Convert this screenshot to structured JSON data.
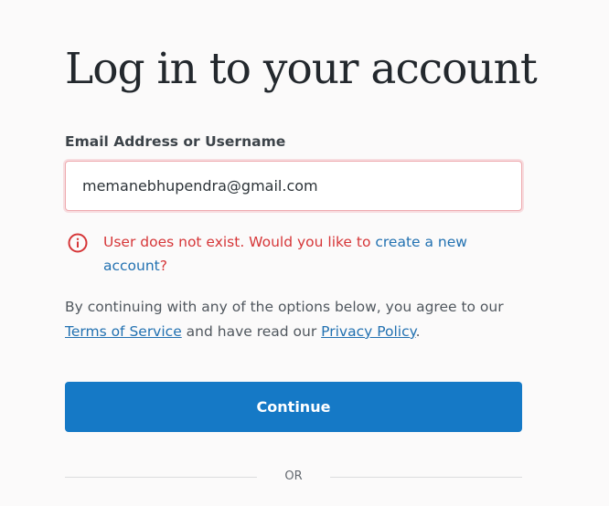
{
  "page": {
    "title": "Log in to your account"
  },
  "form": {
    "email_label": "Email Address or Username",
    "email_value": "memanebhupendra@gmail.com"
  },
  "error": {
    "icon": "alert-circle-icon",
    "prefix": "User does not exist. Would you like to ",
    "link_text": "create a new account",
    "suffix": "?",
    "color": "#d63638"
  },
  "terms": {
    "prefix": "By continuing with any of the options below, you agree to our ",
    "tos_link": "Terms of Service",
    "middle": " and have read our ",
    "privacy_link": "Privacy Policy",
    "suffix": "."
  },
  "actions": {
    "continue_label": "Continue",
    "accent": "#1579c6"
  },
  "divider": {
    "label": "OR"
  }
}
